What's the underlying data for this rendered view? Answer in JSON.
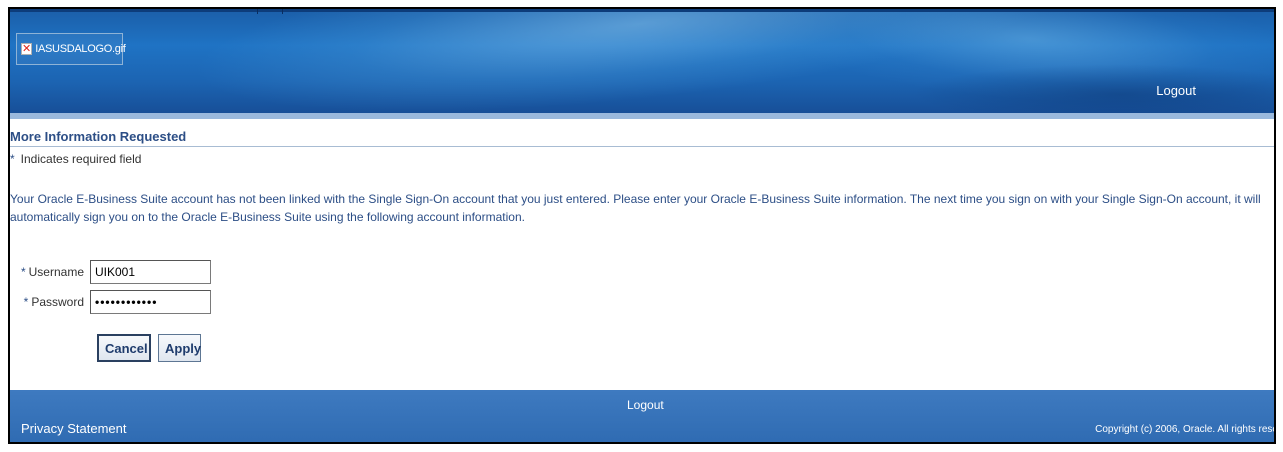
{
  "header": {
    "logo_alt_text": "IASUSDALOGO.gif",
    "logout_label": "Logout"
  },
  "page": {
    "title": "More Information Requested",
    "required_note": "Indicates required field",
    "instructions": "Your Oracle E-Business Suite account has not been linked with the Single Sign-On account that you just entered. Please enter your Oracle E-Business Suite information. The next time you sign on with your Single Sign-On account, it will automatically sign you on to the Oracle E-Business Suite using the following account information."
  },
  "form": {
    "username_label": "Username",
    "username_value": "UIK001",
    "password_label": "Password",
    "password_value": "••••••••••••",
    "cancel_label": "Cancel",
    "apply_label": "Apply"
  },
  "footer": {
    "logout_label": "Logout",
    "privacy_label": "Privacy Statement",
    "copyright": "Copyright (c) 2006, Oracle. All rights rese"
  },
  "colors": {
    "brand_blue": "#1f73c4",
    "title_text": "#2c4e86",
    "footer_blue": "#3e7ac0"
  }
}
